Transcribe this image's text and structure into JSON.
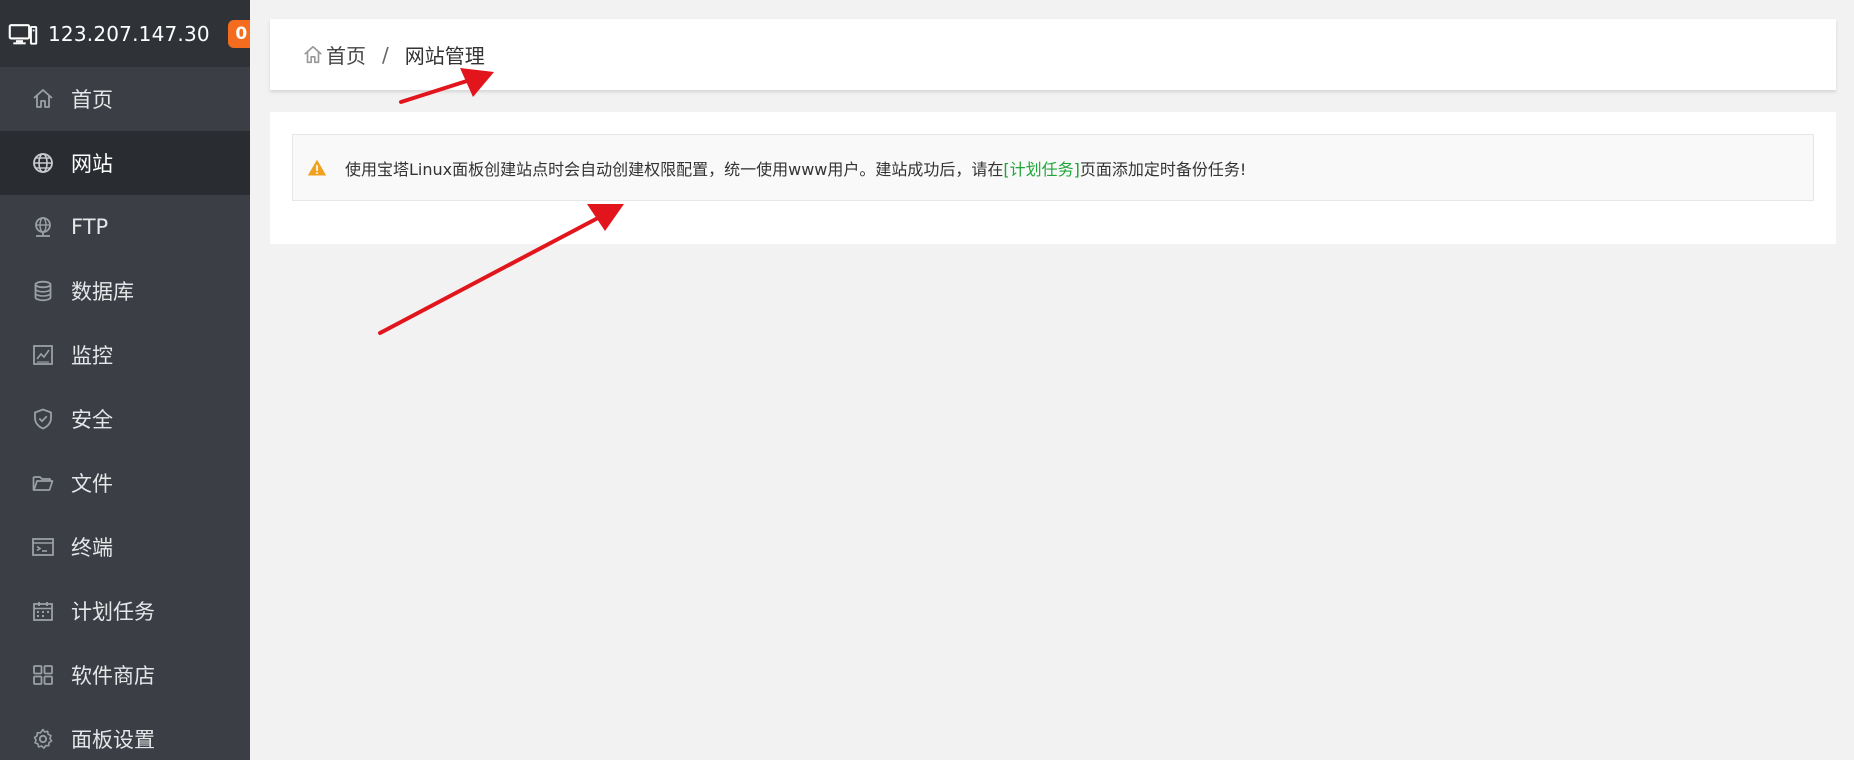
{
  "header": {
    "server_ip": "123.207.147.30",
    "message_count": "0"
  },
  "sidebar": {
    "items": [
      {
        "label": "首页",
        "icon": "home-icon"
      },
      {
        "label": "网站",
        "icon": "globe-icon",
        "active": true
      },
      {
        "label": "FTP",
        "icon": "ftp-icon"
      },
      {
        "label": "数据库",
        "icon": "database-icon"
      },
      {
        "label": "监控",
        "icon": "monitor-chart-icon"
      },
      {
        "label": "安全",
        "icon": "shield-icon"
      },
      {
        "label": "文件",
        "icon": "folder-icon"
      },
      {
        "label": "终端",
        "icon": "terminal-icon"
      },
      {
        "label": "计划任务",
        "icon": "calendar-icon"
      },
      {
        "label": "软件商店",
        "icon": "grid-icon"
      },
      {
        "label": "面板设置",
        "icon": "gear-icon"
      }
    ]
  },
  "breadcrumb": {
    "home": "首页",
    "separator": "/",
    "current": "网站管理"
  },
  "notice": {
    "text_before": "使用宝塔Linux面板创建站点时会自动创建权限配置，统一使用www用户。建站成功后，请在",
    "link": "[计划任务]",
    "text_after": "页面添加定时备份任务!"
  },
  "colors": {
    "sidebar_bg": "#3b3f45",
    "sidebar_header_bg": "#2f3338",
    "active_bg": "#292c31",
    "badge": "#f46d1f",
    "link": "#20a53a",
    "warning": "#f0a120",
    "annotation_arrow": "#e3151c"
  }
}
